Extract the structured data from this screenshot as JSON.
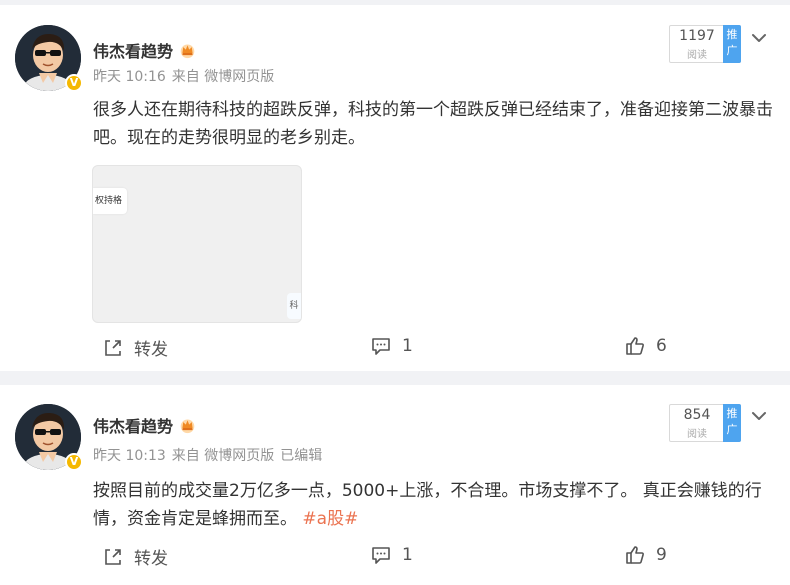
{
  "posts": [
    {
      "author": "伟杰看趋势",
      "time": "昨天 10:16",
      "source": "来自 微博网页版",
      "edited": "",
      "text": "很多人还在期待科技的超跌反弹，科技的第一个超跌反弹已经结束了，准备迎接第二波暴击吧。现在的走势很明显的老乡别走。",
      "hashtag": "",
      "reads": "1197",
      "reads_label": "阅读",
      "push_label": "推广",
      "thumb_chip": "权持格",
      "thumb_chip2": "科",
      "forward_label": "转发",
      "comments": "1",
      "likes": "6"
    },
    {
      "author": "伟杰看趋势",
      "time": "昨天 10:13",
      "source": "来自 微博网页版",
      "edited": "已编辑",
      "text": "按照目前的成交量2万亿多一点，5000+上涨，不合理。市场支撑不了。 真正会赚钱的行情，资金肯定是蜂拥而至。 ",
      "hashtag": "#a股#",
      "reads": "854",
      "reads_label": "阅读",
      "push_label": "推广",
      "forward_label": "转发",
      "comments": "1",
      "likes": "9"
    }
  ],
  "verified_badge": "V",
  "colors": {
    "background": "#f1f2f5",
    "card": "#ffffff",
    "meta": "#939393",
    "hashtag": "#eb7350",
    "push": "#4ea4ef",
    "badge": "#f5b800"
  },
  "icons": [
    "more-chevron-icon",
    "forward-icon",
    "comment-icon",
    "like-icon",
    "crown-icon"
  ]
}
